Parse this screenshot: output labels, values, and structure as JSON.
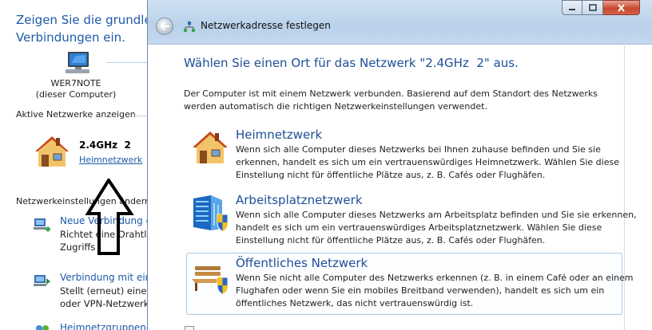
{
  "background": {
    "heading_lines": [
      "Zeigen Sie die grundleg",
      "Verbindungen ein."
    ],
    "computer": {
      "icon": "computer-monitor-icon",
      "name_lines": [
        "WER7NOTE",
        "(dieser Computer)"
      ]
    },
    "active_networks_label": "Aktive Netzwerke anzeigen",
    "active_network": {
      "icon": "house-icon",
      "name": "2.4GHz  2",
      "type_link": "Heimnetzwerk"
    },
    "annotation": {
      "icon": "up-arrow-outline-icon"
    },
    "settings_label": "Netzwerkeinstellungen ändern",
    "tasks": [
      {
        "icon": "new-connection-icon",
        "link": "Neue Verbindung oder neues Netzwerk einrichten",
        "desc_lines": [
          "Richtet eine Drahtlos",
          "Zugriffs"
        ]
      },
      {
        "icon": "connect-network-icon",
        "link": "Verbindung mit einem Netzwerk herstellen",
        "desc_lines": [
          "Stellt (erneut) eine V",
          "oder VPN-Netzwerk"
        ]
      },
      {
        "icon": "homegroup-icon",
        "link": "Heimnetzgruppen- und Freigabeoptionen auswählen",
        "desc_lines": []
      }
    ]
  },
  "dialog": {
    "title": "Netzwerkadresse festlegen",
    "back_icon": "back-arrow-icon",
    "title_icon": "network-icon",
    "window_buttons": {
      "minimize": "minimize-icon",
      "maximize": "maximize-icon",
      "close": "close-icon"
    },
    "heading": "Wählen Sie einen Ort für das Netzwerk \"2.4GHz  2\" aus.",
    "intro_lines": [
      "Der Computer ist mit einem Netzwerk verbunden. Basierend auf dem Standort des Netzwerks",
      "werden automatisch die richtigen Netzwerkeinstellungen verwendet."
    ],
    "options": [
      {
        "title": "Heimnetzwerk",
        "icon": "house-icon",
        "desc_lines": [
          "Wenn sich alle Computer dieses Netzwerks bei Ihnen zuhause befinden und Sie sie",
          "erkennen, handelt es sich um ein vertrauenswürdiges Heimnetzwerk. Wählen Sie diese",
          "Einstellung nicht für öffentliche Plätze aus, z. B. Cafés oder Flughäfen."
        ]
      },
      {
        "title": "Arbeitsplatznetzwerk",
        "icon": "office-building-icon",
        "desc_lines": [
          "Wenn sich alle Computer dieses Netzwerks am Arbeitsplatz befinden und Sie sie erkennen,",
          "handelt es sich um ein vertrauenswürdiges Arbeitsplatznetzwerk. Wählen Sie diese",
          "Einstellung nicht für öffentliche Plätze aus, z. B. Cafés oder Flughäfen."
        ]
      },
      {
        "title": "Öffentliches Netzwerk",
        "icon": "park-bench-icon",
        "desc_lines": [
          "Wenn Sie nicht alle Computer des Netzwerks erkennen (z. B. in einem Café oder an einem",
          "Flughafen oder wenn Sie ein mobiles Breitband verwenden), handelt es sich um ein",
          "öffentliches Netzwerk, das nicht vertrauenswürdig ist."
        ]
      }
    ],
    "checkbox_icon": "checkbox-icon"
  },
  "colors": {
    "link": "#1e5aa8",
    "heading": "#1e4f96",
    "titlebar": "#c4d8ee",
    "close": "#c7492f",
    "selection_border": "#a9cbe5"
  }
}
